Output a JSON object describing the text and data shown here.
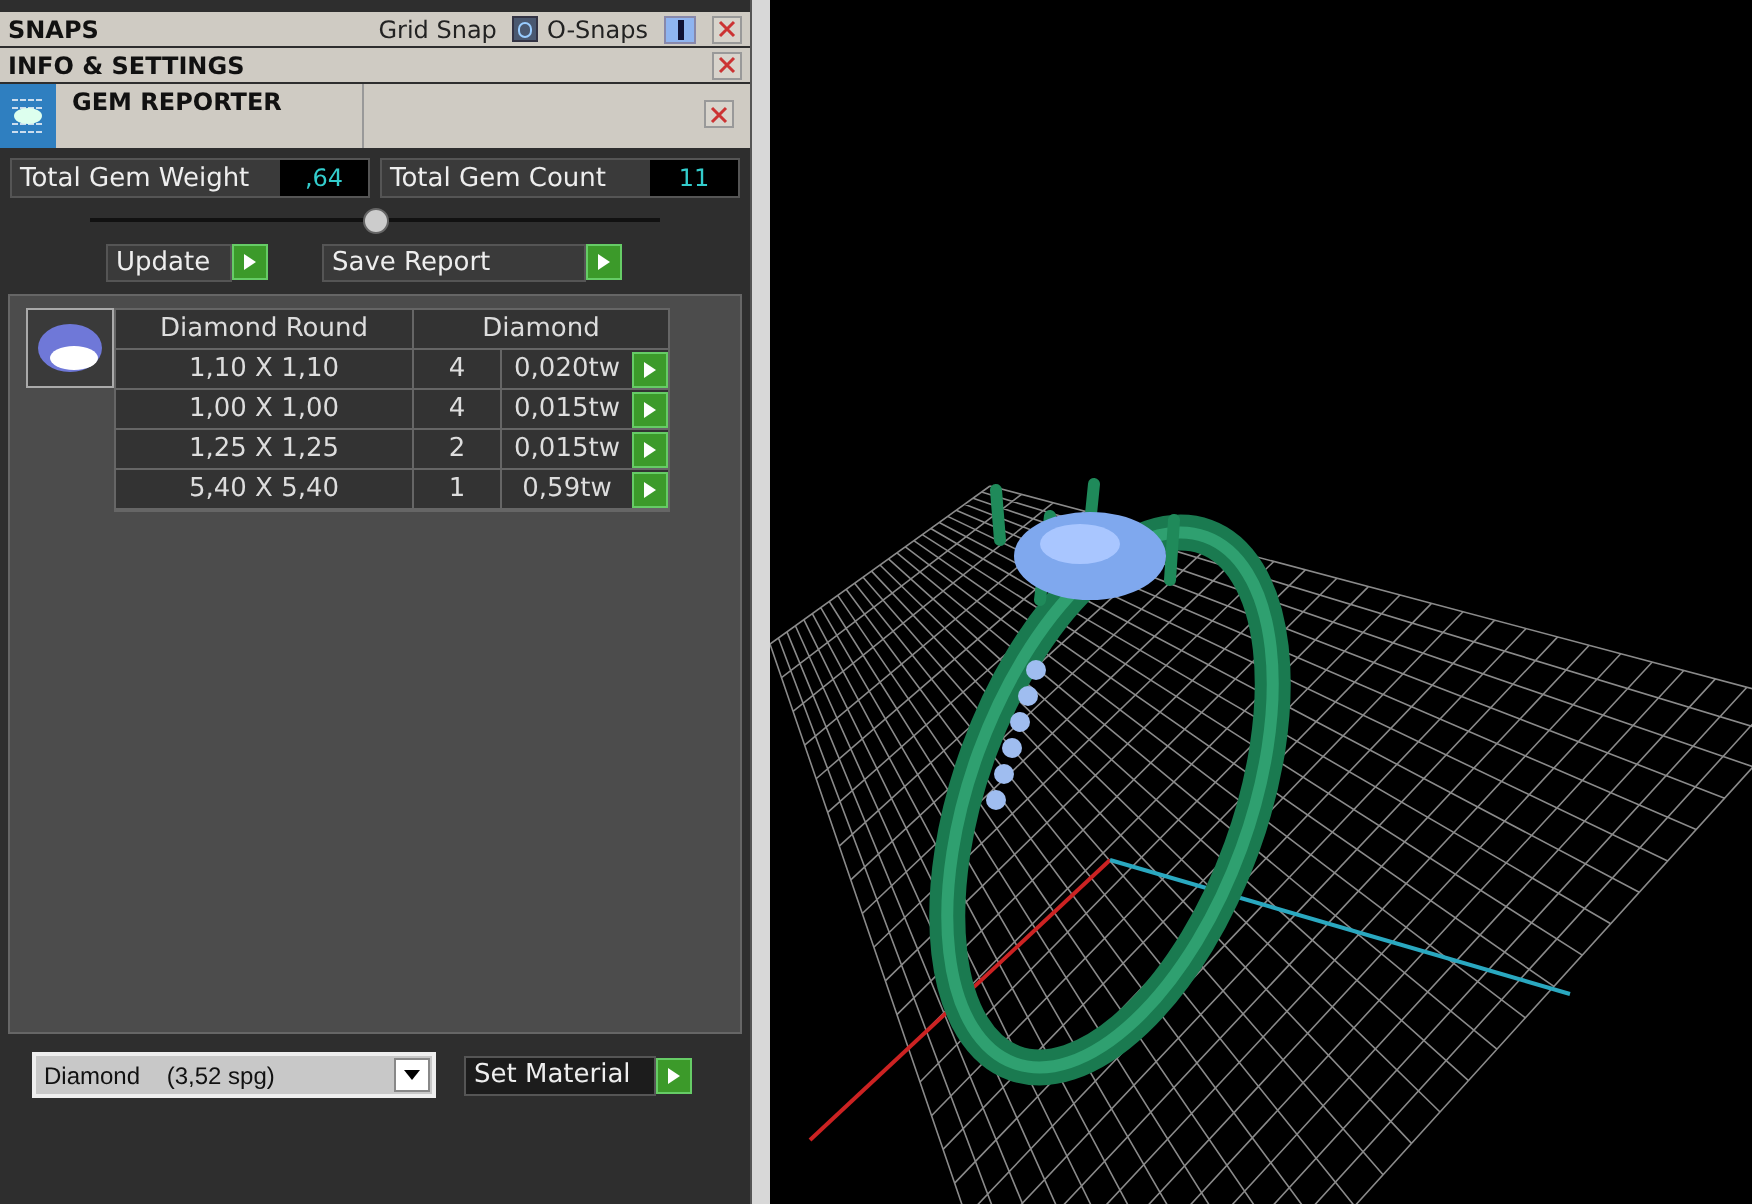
{
  "snaps_bar": {
    "title": "SNAPS",
    "grid_snap": {
      "label": "Grid Snap",
      "on": false
    },
    "o_snaps": {
      "label": "O-Snaps",
      "on": true
    }
  },
  "info_bar": {
    "title": "INFO & SETTINGS"
  },
  "gem_reporter": {
    "title": "GEM REPORTER",
    "totals": [
      {
        "label": "Total Gem Weight",
        "value": ",64"
      },
      {
        "label": "Total Gem Count",
        "value": "11"
      }
    ],
    "slider": {
      "level": 0.5
    },
    "buttons": [
      "Update",
      "Save Report"
    ],
    "table": {
      "columns": [
        "Diamond Round",
        "Diamond"
      ],
      "rows": [
        {
          "size": "1,10 X 1,10",
          "count": "4",
          "weight": "0,020tw"
        },
        {
          "size": "1,00 X 1,00",
          "count": "4",
          "weight": "0,015tw"
        },
        {
          "size": "1,25 X 1,25",
          "count": "2",
          "weight": "0,015tw"
        },
        {
          "size": "5,40 X 5,40",
          "count": "1",
          "weight": "0,59tw"
        }
      ]
    },
    "material": {
      "value": "Diamond    (3,52 spg)",
      "button": "Set Material"
    }
  }
}
